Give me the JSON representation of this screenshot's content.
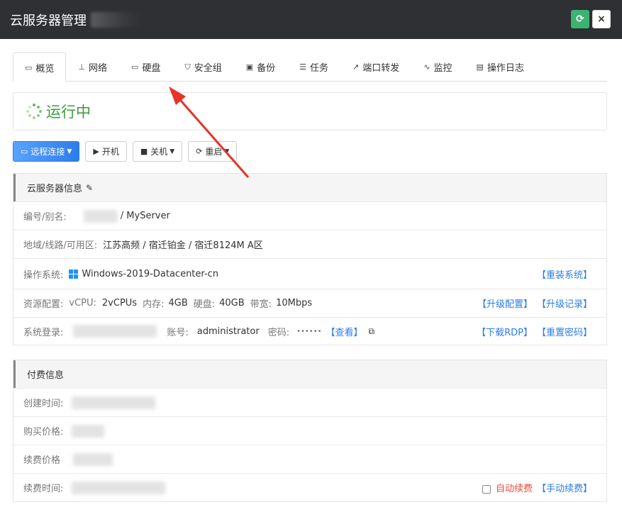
{
  "titlebar": {
    "title": "云服务器管理",
    "refresh_icon": "refresh-icon",
    "close_label": "×"
  },
  "tabs": [
    {
      "label": "概览",
      "icon": "▭",
      "active": true
    },
    {
      "label": "网络",
      "icon": "⊥"
    },
    {
      "label": "硬盘",
      "icon": "▭"
    },
    {
      "label": "安全组",
      "icon": "⛉"
    },
    {
      "label": "备份",
      "icon": "▣"
    },
    {
      "label": "任务",
      "icon": "☰"
    },
    {
      "label": "端口转发",
      "icon": "↗"
    },
    {
      "label": "监控",
      "icon": "∿"
    },
    {
      "label": "操作日志",
      "icon": "▤"
    }
  ],
  "status": {
    "text": "运行中",
    "color": "#3c9a3c"
  },
  "actions": {
    "remote": "远程连接",
    "start": "开机",
    "shutdown": "关机",
    "restart": "重启"
  },
  "server_info": {
    "title": "云服务器信息",
    "id_label": "编号/别名:",
    "alias": "/ MyServer",
    "region_label": "地域/线路/可用区:",
    "region_value": "江苏高频 / 宿迁铂金 / 宿迁8124M A区",
    "os_label": "操作系统:",
    "os_value": "Windows-2019-Datacenter-cn",
    "reinstall": "【重装系统】",
    "res_label": "资源配置:",
    "vcpu_label": "vCPU:",
    "vcpu_value": "2vCPUs",
    "mem_label": "内存:",
    "mem_value": "4GB",
    "disk_label": "硬盘:",
    "disk_value": "40GB",
    "bw_label": "带宽:",
    "bw_value": "10Mbps",
    "upgrade": "【升级配置】",
    "upgrade_log": "【升级记录】",
    "login_label": "系统登录:",
    "account_label": "账号:",
    "account_value": "administrator",
    "pwd_label": "密码:",
    "pwd_value": "••••••",
    "view": "【查看】",
    "download_rdp": "【下载RDP】",
    "reset_pwd": "【重置密码】"
  },
  "billing": {
    "title": "付费信息",
    "created_label": "创建时间:",
    "price_label": "购买价格:",
    "renew_price_label": "续费价格",
    "renew_time_label": "续费时间:",
    "auto_renew": "自动续费",
    "manual_renew": "【手动续费】"
  },
  "colors": {
    "accent": "#2b7de9",
    "running": "#3c9a3c",
    "danger": "#e84c3d",
    "arrow": "#e8332a"
  }
}
